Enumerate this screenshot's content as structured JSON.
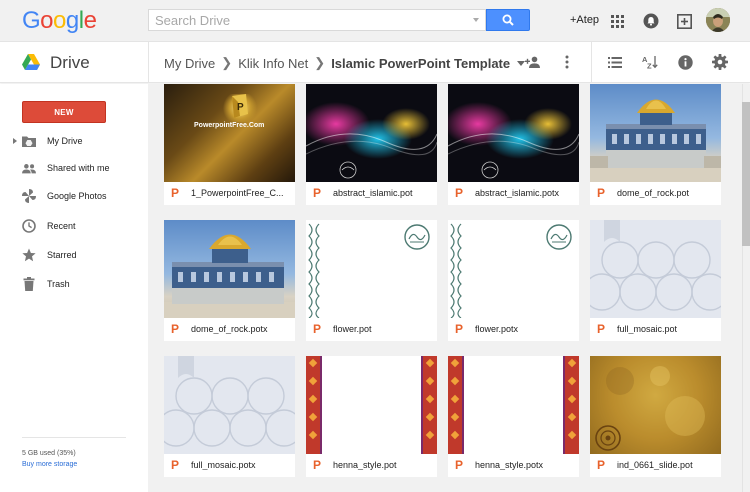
{
  "header": {
    "logo_letters": [
      {
        "ch": "G",
        "color": "#4285f4"
      },
      {
        "ch": "o",
        "color": "#ea4335"
      },
      {
        "ch": "o",
        "color": "#fbbc05"
      },
      {
        "ch": "g",
        "color": "#4285f4"
      },
      {
        "ch": "l",
        "color": "#34a853"
      },
      {
        "ch": "e",
        "color": "#ea4335"
      }
    ],
    "search_placeholder": "Search Drive",
    "search_value": "",
    "plus_user": "+Atep",
    "icons": [
      "apps-grid-icon",
      "notifications-icon",
      "share-plus-icon",
      "account-avatar"
    ]
  },
  "subbar": {
    "app_name": "Drive",
    "breadcrumb": [
      "My Drive",
      "Klik Info Net",
      "Islamic PowerPoint Template"
    ],
    "actions": [
      "add-person-icon",
      "more-vert-icon",
      "list-view-icon",
      "sort-az-icon",
      "info-icon",
      "settings-icon"
    ]
  },
  "sidebar": {
    "new_label": "NEW",
    "items": [
      {
        "label": "My Drive",
        "icon": "drive-folder-icon",
        "expandable": true
      },
      {
        "label": "Shared with me",
        "icon": "people-icon",
        "expandable": false
      },
      {
        "label": "Google Photos",
        "icon": "photos-pinwheel-icon",
        "expandable": false
      },
      {
        "label": "Recent",
        "icon": "clock-icon",
        "expandable": false
      },
      {
        "label": "Starred",
        "icon": "star-icon",
        "expandable": false
      },
      {
        "label": "Trash",
        "icon": "trash-icon",
        "expandable": false
      }
    ],
    "storage_text": "5 GB used (35%)",
    "storage_fraction": 0.35,
    "buy_more": "Buy more storage"
  },
  "files": [
    {
      "name": "1_PowerpointFree_C...",
      "thumb": "ppt",
      "thumb_text": "PowerpointFree.Com",
      "type_icon": "P"
    },
    {
      "name": "abstract_islamic.pot",
      "thumb": "abstract",
      "type_icon": "P"
    },
    {
      "name": "abstract_islamic.potx",
      "thumb": "abstract",
      "type_icon": "P"
    },
    {
      "name": "dome_of_rock.pot",
      "thumb": "dome",
      "type_icon": "P"
    },
    {
      "name": "dome_of_rock.potx",
      "thumb": "dome",
      "type_icon": "P"
    },
    {
      "name": "flower.pot",
      "thumb": "flower",
      "type_icon": "P"
    },
    {
      "name": "flower.potx",
      "thumb": "flower",
      "type_icon": "P"
    },
    {
      "name": "full_mosaic.pot",
      "thumb": "mosaic",
      "type_icon": "P"
    },
    {
      "name": "full_mosaic.potx",
      "thumb": "mosaic",
      "type_icon": "P"
    },
    {
      "name": "henna_style.pot",
      "thumb": "henna",
      "type_icon": "P"
    },
    {
      "name": "henna_style.potx",
      "thumb": "henna",
      "type_icon": "P"
    },
    {
      "name": "ind_0661_slide.pot",
      "thumb": "grunge",
      "type_icon": "P"
    }
  ],
  "colors": {
    "accent_blue": "#4d90fe",
    "new_button": "#dd4b39",
    "ppt_icon": "#e8622c",
    "link": "#2a6dd6"
  }
}
